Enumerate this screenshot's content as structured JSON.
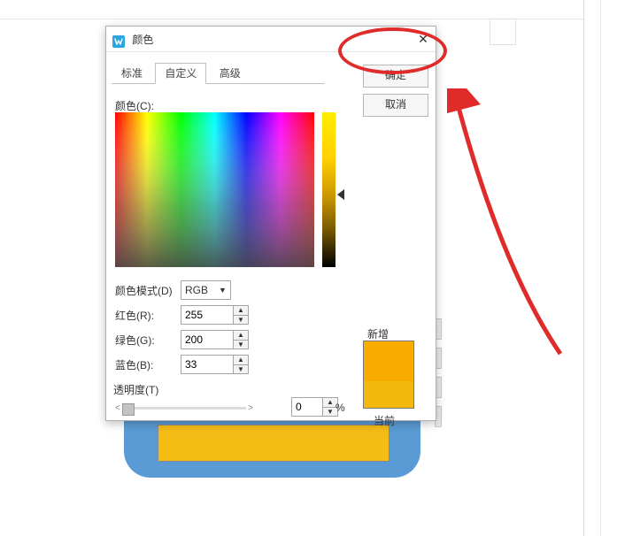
{
  "dialog": {
    "title": "颜色",
    "tabs": {
      "standard": "标准",
      "custom": "自定义",
      "advanced": "高级"
    },
    "active_tab": "custom",
    "ok_label": "确定",
    "cancel_label": "取消",
    "color_label": "颜色(C):",
    "mode_label": "颜色模式(D)",
    "mode_value": "RGB",
    "red_label": "红色(R):",
    "green_label": "绿色(G):",
    "blue_label": "蓝色(B):",
    "red_value": "255",
    "green_value": "200",
    "blue_value": "33",
    "new_label": "新增",
    "current_label": "当前",
    "transparency_label": "透明度(T)",
    "transparency_value": "0",
    "transparency_unit": "%",
    "new_color": "#f9ac00",
    "current_color": "#f3b90c"
  }
}
